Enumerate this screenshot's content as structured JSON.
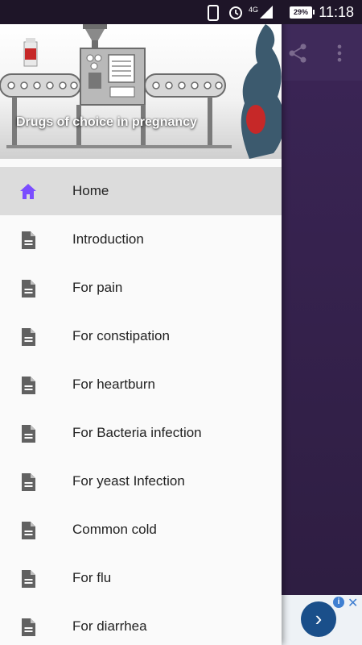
{
  "status_bar": {
    "time": "11:18",
    "battery": "29%",
    "network": "4G"
  },
  "header": {
    "title": "Drugs of choice in pregnancy"
  },
  "menu": [
    {
      "label": "Home",
      "icon": "home-icon",
      "active": true
    },
    {
      "label": "Introduction",
      "icon": "document-icon"
    },
    {
      "label": "For pain",
      "icon": "document-icon"
    },
    {
      "label": "For constipation",
      "icon": "document-icon"
    },
    {
      "label": "For heartburn",
      "icon": "document-icon"
    },
    {
      "label": "For Bacteria infection",
      "icon": "document-icon"
    },
    {
      "label": "For yeast Infection",
      "icon": "document-icon"
    },
    {
      "label": "Common cold",
      "icon": "document-icon"
    },
    {
      "label": "For flu",
      "icon": "document-icon"
    },
    {
      "label": "For diarrhea",
      "icon": "document-icon"
    }
  ],
  "colors": {
    "accent": "#7b4dff",
    "toolbar": "#3f2a5a",
    "icon_gray": "#616161"
  }
}
